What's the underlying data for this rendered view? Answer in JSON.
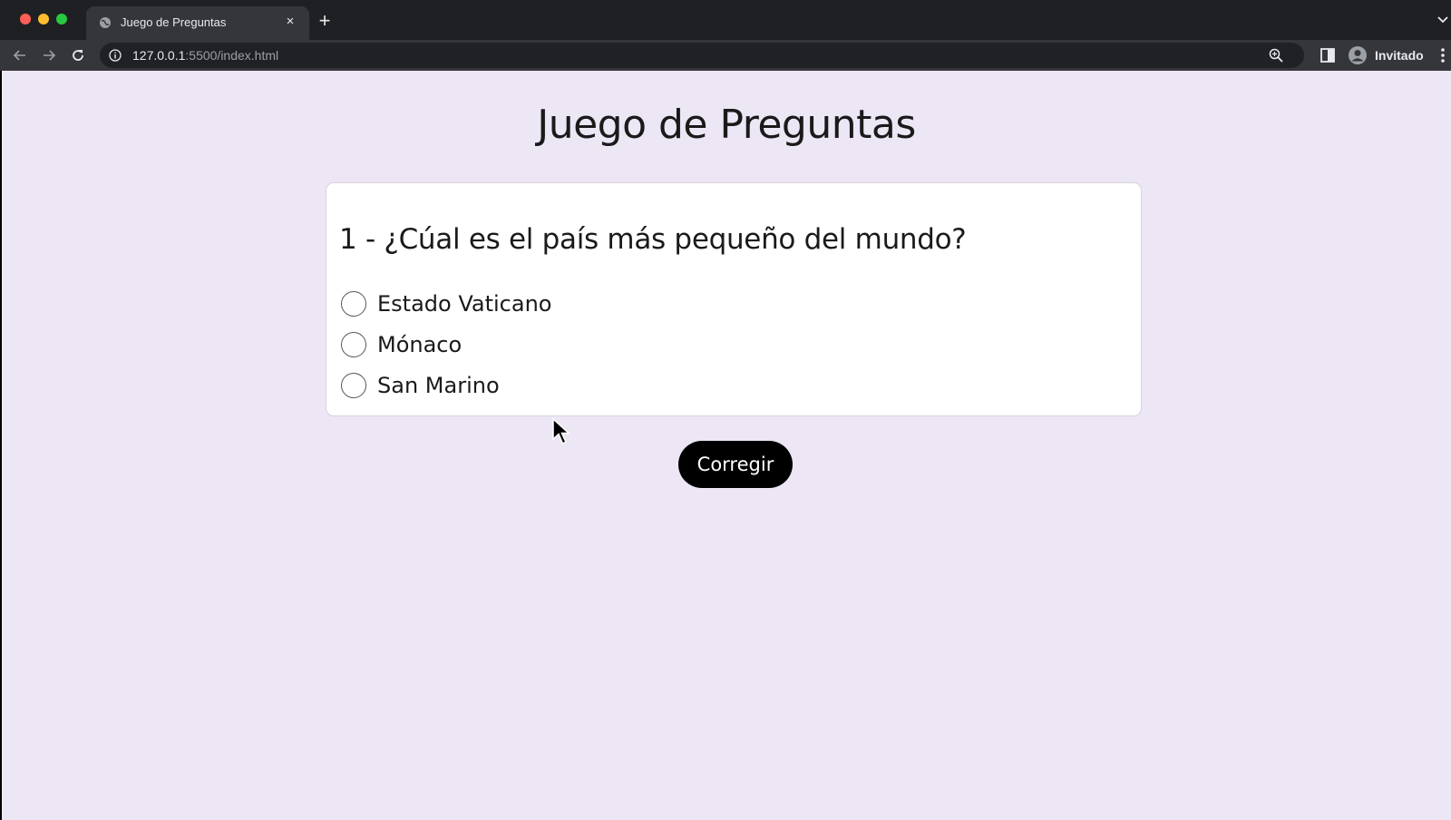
{
  "browser": {
    "tab_title": "Juego de Preguntas",
    "tab_close": "×",
    "new_tab": "+",
    "url_host": "127.0.0.1",
    "url_rest": ":5500/index.html",
    "profile_label": "Invitado"
  },
  "page": {
    "title": "Juego de Preguntas",
    "question": "1 - ¿Cúal es el país más pequeño del mundo?",
    "options": [
      "Estado Vaticano",
      "Mónaco",
      "San Marino"
    ],
    "submit_label": "Corregir"
  },
  "colors": {
    "page_background": "#ede6f5",
    "card_background": "#ffffff",
    "button_background": "#000000"
  }
}
